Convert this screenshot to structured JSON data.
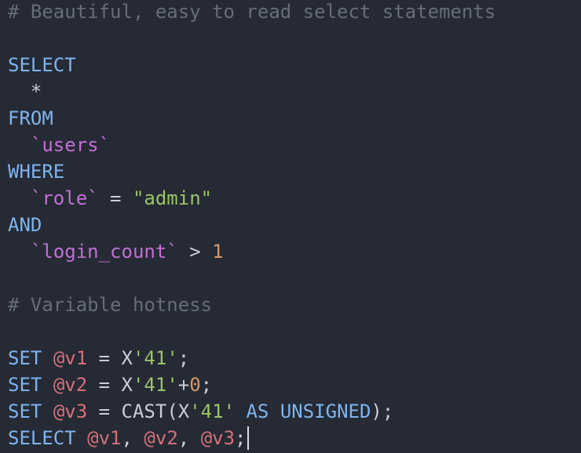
{
  "editor": {
    "lines": [
      {
        "tokens": [
          {
            "t": "comment",
            "v": "# Beautiful, easy to read select statements"
          }
        ]
      },
      {
        "tokens": []
      },
      {
        "tokens": [
          {
            "t": "kw",
            "v": "SELECT"
          }
        ]
      },
      {
        "tokens": [
          {
            "t": "op",
            "v": "  *"
          }
        ]
      },
      {
        "tokens": [
          {
            "t": "kw",
            "v": "FROM"
          }
        ]
      },
      {
        "tokens": [
          {
            "t": "ident",
            "v": "  `users`"
          }
        ]
      },
      {
        "tokens": [
          {
            "t": "kw",
            "v": "WHERE"
          }
        ]
      },
      {
        "tokens": [
          {
            "t": "ident",
            "v": "  `role`"
          },
          {
            "t": "op",
            "v": " = "
          },
          {
            "t": "str",
            "v": "\"admin\""
          }
        ]
      },
      {
        "tokens": [
          {
            "t": "kw",
            "v": "AND"
          }
        ]
      },
      {
        "tokens": [
          {
            "t": "ident",
            "v": "  `login_count`"
          },
          {
            "t": "op",
            "v": " > "
          },
          {
            "t": "num",
            "v": "1"
          }
        ]
      },
      {
        "tokens": []
      },
      {
        "tokens": [
          {
            "t": "comment",
            "v": "# Variable hotness"
          }
        ]
      },
      {
        "tokens": []
      },
      {
        "tokens": [
          {
            "t": "kw",
            "v": "SET"
          },
          {
            "t": "op",
            "v": " "
          },
          {
            "t": "var",
            "v": "@v1"
          },
          {
            "t": "op",
            "v": " = X"
          },
          {
            "t": "str",
            "v": "'41'"
          },
          {
            "t": "op",
            "v": ";"
          }
        ]
      },
      {
        "tokens": [
          {
            "t": "kw",
            "v": "SET"
          },
          {
            "t": "op",
            "v": " "
          },
          {
            "t": "var",
            "v": "@v2"
          },
          {
            "t": "op",
            "v": " = X"
          },
          {
            "t": "str",
            "v": "'41'"
          },
          {
            "t": "op",
            "v": "+"
          },
          {
            "t": "num",
            "v": "0"
          },
          {
            "t": "op",
            "v": ";"
          }
        ]
      },
      {
        "tokens": [
          {
            "t": "kw",
            "v": "SET"
          },
          {
            "t": "op",
            "v": " "
          },
          {
            "t": "var",
            "v": "@v3"
          },
          {
            "t": "op",
            "v": " = CAST(X"
          },
          {
            "t": "str",
            "v": "'41'"
          },
          {
            "t": "op",
            "v": " "
          },
          {
            "t": "kw",
            "v": "AS"
          },
          {
            "t": "op",
            "v": " "
          },
          {
            "t": "kw",
            "v": "UNSIGNED"
          },
          {
            "t": "op",
            "v": ");"
          }
        ]
      },
      {
        "tokens": [
          {
            "t": "kw",
            "v": "SELECT"
          },
          {
            "t": "op",
            "v": " "
          },
          {
            "t": "var",
            "v": "@v1"
          },
          {
            "t": "op",
            "v": ", "
          },
          {
            "t": "var",
            "v": "@v2"
          },
          {
            "t": "op",
            "v": ", "
          },
          {
            "t": "var",
            "v": "@v3"
          },
          {
            "t": "op",
            "v": ";"
          }
        ],
        "cursor_at_end": true
      }
    ],
    "colors": {
      "background": "#252a34",
      "comment": "#666d79",
      "keyword": "#7fb4ee",
      "identifier": "#c36fd6",
      "string": "#9bc46a",
      "number": "#d5976b",
      "variable": "#d6707a",
      "plain": "#c9ced8"
    }
  }
}
